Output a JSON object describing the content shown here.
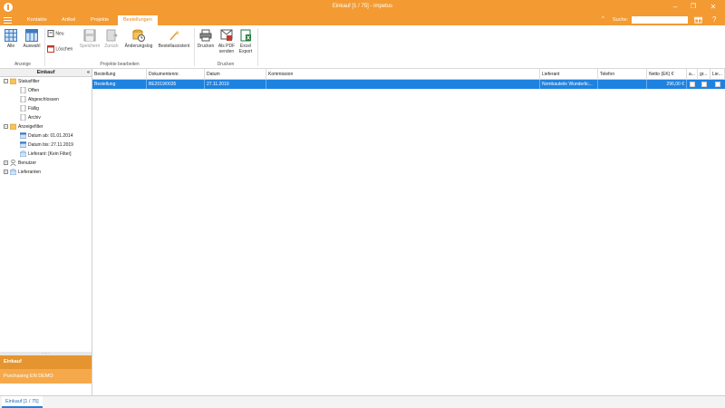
{
  "window": {
    "title": "Einkauf [1 / 75] - impetus",
    "minimize": "–",
    "maximize": "❐",
    "close": "✕"
  },
  "tabs": [
    {
      "label": "Kontakte"
    },
    {
      "label": "Artikel"
    },
    {
      "label": "Projekte"
    },
    {
      "label": "Bestellungen"
    }
  ],
  "search": {
    "label": "Suche:",
    "value": ""
  },
  "ribbon": {
    "alle": "Alle",
    "auswahl": "Auswahl",
    "neu": "Neu",
    "loeschen": "Löschen",
    "speichern": "Speichern",
    "zurueck": "Zurück",
    "aenderungslog": "Änderungslog",
    "bestellassistent": "Bestellassistent",
    "drucken": "Drucken",
    "als_pdf_1": "Als PDF",
    "als_pdf_2": "senden",
    "excel_1": "Excel",
    "excel_2": "Export",
    "group_anzeige": "Anzeige",
    "group_projekte": "Projekte bearbeiten",
    "group_drucken": "Drucken"
  },
  "leftpanel": {
    "header": "Einkauf",
    "collapse": "«",
    "tree": {
      "statusfilter": "Statusfilter",
      "offen": "Offen",
      "abgeschlossen": "Abgeschlossen",
      "faellig": "Fällig",
      "archiv": "Archiv",
      "anzeigefilter": "Anzeigefilter",
      "datum_ab": "Datum ab: 01.01.2014",
      "datum_bis": "Datum bis: 27.11.2019",
      "lieferant": "Lieferant: [Kein Filter]",
      "benutzer": "Benutzer",
      "lieferanten": "Lieferanten"
    },
    "nav_einkauf": "Einkauf",
    "nav_purchasing": "Purchasing EN DEMO"
  },
  "grid": {
    "columns": [
      "Bestellung",
      "Dokumentennr.",
      "Datum",
      "Kommission",
      "Lieferant",
      "Telefon",
      "Netto (EK) €",
      "a...",
      "gr...",
      "Lie..."
    ],
    "rows": [
      {
        "bestellung": "Bestellung",
        "dokumentennr": "BE2019/0035",
        "datum": "27.11.2019",
        "kommission": "",
        "lieferant": "Nombauteile Wunderlic...",
        "telefon": "",
        "netto": "296,00 €"
      }
    ]
  },
  "status": {
    "tab": "Einkauf [1 / 75]"
  },
  "colors": {
    "accent": "#f39a32",
    "selection": "#1e82e0",
    "nav_active": "#e5952f"
  }
}
